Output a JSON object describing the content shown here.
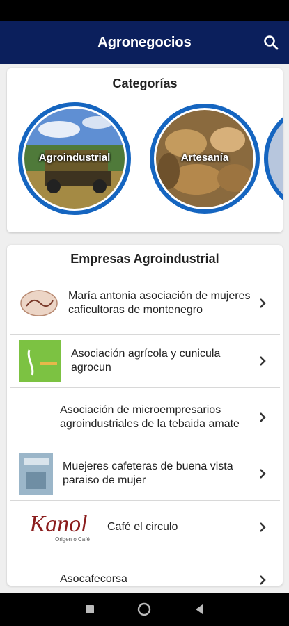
{
  "appbar": {
    "title": "Agronegocios",
    "search_icon": "search-icon"
  },
  "categories": {
    "title": "Categorías",
    "items": [
      {
        "label": "Agroindustrial"
      },
      {
        "label": "Artesanía"
      }
    ]
  },
  "companies": {
    "title": "Empresas Agroindustrial",
    "items": [
      {
        "name": "María antonia asociación de mujeres caficultoras de montenegro"
      },
      {
        "name": "Asociación agrícola y cunicula agrocun"
      },
      {
        "name": "Asociación de microempresarios agroindustriales de la tebaida amate"
      },
      {
        "name": "Muejeres cafeteras de buena vista paraiso de mujer"
      },
      {
        "name": "Café el circulo",
        "logo_text": "Kanol",
        "logo_sub": "Origen o Café"
      },
      {
        "name": "Asocafecorsa"
      }
    ]
  },
  "colors": {
    "appbar": "#0b1f5c",
    "ring": "#1565c0",
    "background": "#efefef"
  }
}
